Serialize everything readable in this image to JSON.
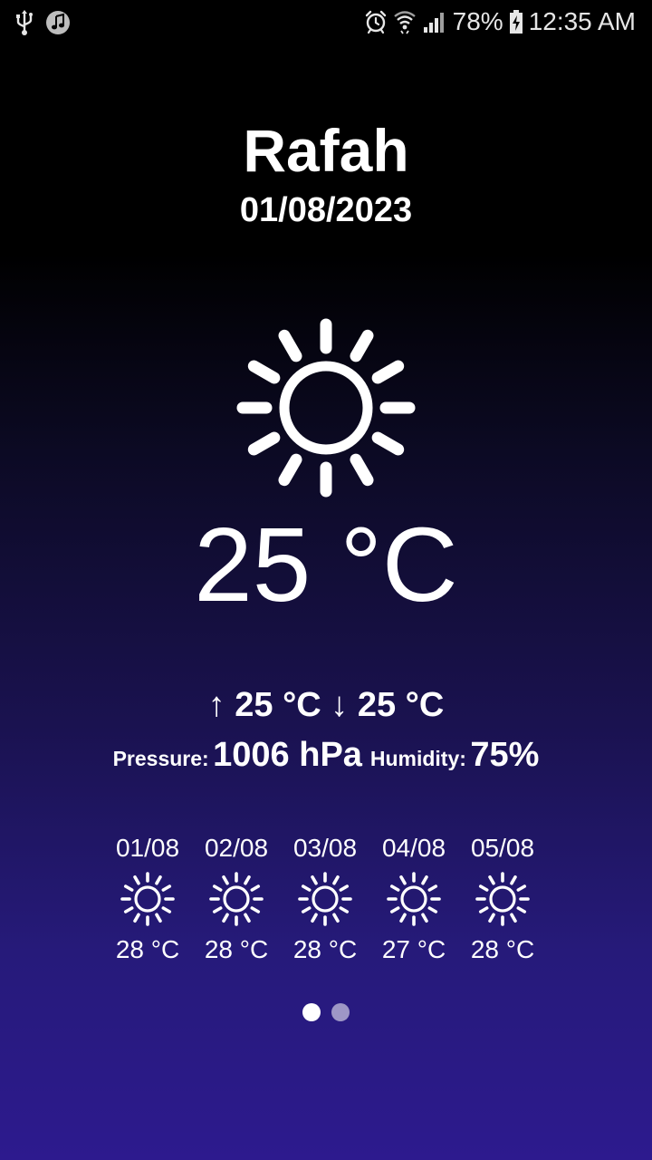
{
  "status_bar": {
    "battery": "78%",
    "time": "12:35 AM",
    "icons": [
      "usb-icon",
      "music-icon",
      "alarm-icon",
      "wifi-icon",
      "signal-icon",
      "battery-charging-icon"
    ]
  },
  "location": {
    "city": "Rafah",
    "date": "01/08/2023"
  },
  "current": {
    "condition_icon": "sun-icon",
    "temperature": "25 °C",
    "max_arrow": "↑",
    "max": "25 °C",
    "min_arrow": "↓",
    "min": "25 °C",
    "pressure_label": "Pressure:",
    "pressure": "1006 hPa",
    "humidity_label": "Humidity:",
    "humidity": "75%"
  },
  "forecast": [
    {
      "date": "01/08",
      "icon": "sun-icon",
      "temp": "28 °C"
    },
    {
      "date": "02/08",
      "icon": "sun-icon",
      "temp": "28 °C"
    },
    {
      "date": "03/08",
      "icon": "sun-icon",
      "temp": "28 °C"
    },
    {
      "date": "04/08",
      "icon": "sun-icon",
      "temp": "27 °C"
    },
    {
      "date": "05/08",
      "icon": "sun-icon",
      "temp": "28 °C"
    }
  ],
  "pager": {
    "pages": 2,
    "active": 1
  },
  "colors": {
    "background_top": "#000000",
    "background_bottom": "#2d1a8e",
    "text": "#ffffff"
  }
}
